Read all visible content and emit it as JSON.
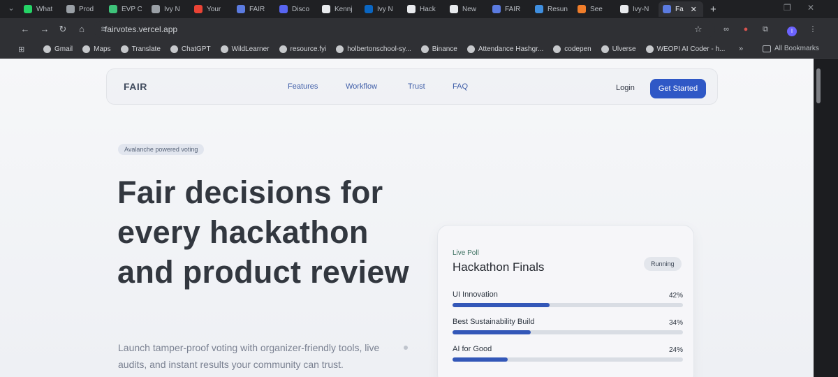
{
  "tabs": [
    {
      "label": "What",
      "color": "#25d366"
    },
    {
      "label": "Prod",
      "color": "#9aa0a6"
    },
    {
      "label": "EVP C",
      "color": "#3ec37a"
    },
    {
      "label": "Ivy N",
      "color": "#9aa0a6"
    },
    {
      "label": "Your",
      "color": "#ea4335"
    },
    {
      "label": "FAIR",
      "color": "#5b7be0"
    },
    {
      "label": "Disco",
      "color": "#5865f2"
    },
    {
      "label": "Kennj",
      "color": "#e8eaed"
    },
    {
      "label": "Ivy N",
      "color": "#0a66c2"
    },
    {
      "label": "Hack",
      "color": "#e8eaed"
    },
    {
      "label": "New",
      "color": "#e8eaed"
    },
    {
      "label": "FAIR",
      "color": "#5b7be0"
    },
    {
      "label": "Resun",
      "color": "#3f8fe0"
    },
    {
      "label": "See",
      "color": "#f07d2a"
    },
    {
      "label": "Ivy-N",
      "color": "#e8eaed"
    },
    {
      "label": "Fa",
      "color": "#5b7be0",
      "active": true
    }
  ],
  "address_bar": {
    "url": "fairvotes.vercel.app"
  },
  "bookmarks": [
    "Gmail",
    "Maps",
    "Translate",
    "ChatGPT",
    "WildLearner",
    "resource.fyi",
    "holbertonschool-sy...",
    "Binance",
    "Attendance Hashgr...",
    "codepen",
    "Ulverse",
    "WEOPI AI Coder - h..."
  ],
  "all_bookmarks_label": "All Bookmarks",
  "site": {
    "logo": "FAIR",
    "nav": {
      "features": "Features",
      "workflow": "Workflow",
      "trust": "Trust",
      "faq": "FAQ"
    },
    "login": "Login",
    "cta": "Get Started",
    "badge": "Avalanche powered voting",
    "headline": "Fair decisions for every hackathon and product review",
    "subtext": "Launch tamper-proof voting with organizer-friendly tools, live audits, and instant results your community can trust.",
    "poll": {
      "kicker": "Live Poll",
      "title": "Hackathon Finals",
      "status": "Running",
      "options": [
        {
          "name": "UI Innovation",
          "pct_label": "42%",
          "pct": 42
        },
        {
          "name": "Best Sustainability Build",
          "pct_label": "34%",
          "pct": 34
        },
        {
          "name": "AI for Good",
          "pct_label": "24%",
          "pct": 24
        }
      ]
    }
  },
  "colors": {
    "accent": "#2f58c6",
    "bar": "#3357b8",
    "poll_kicker": "#3c7060"
  }
}
